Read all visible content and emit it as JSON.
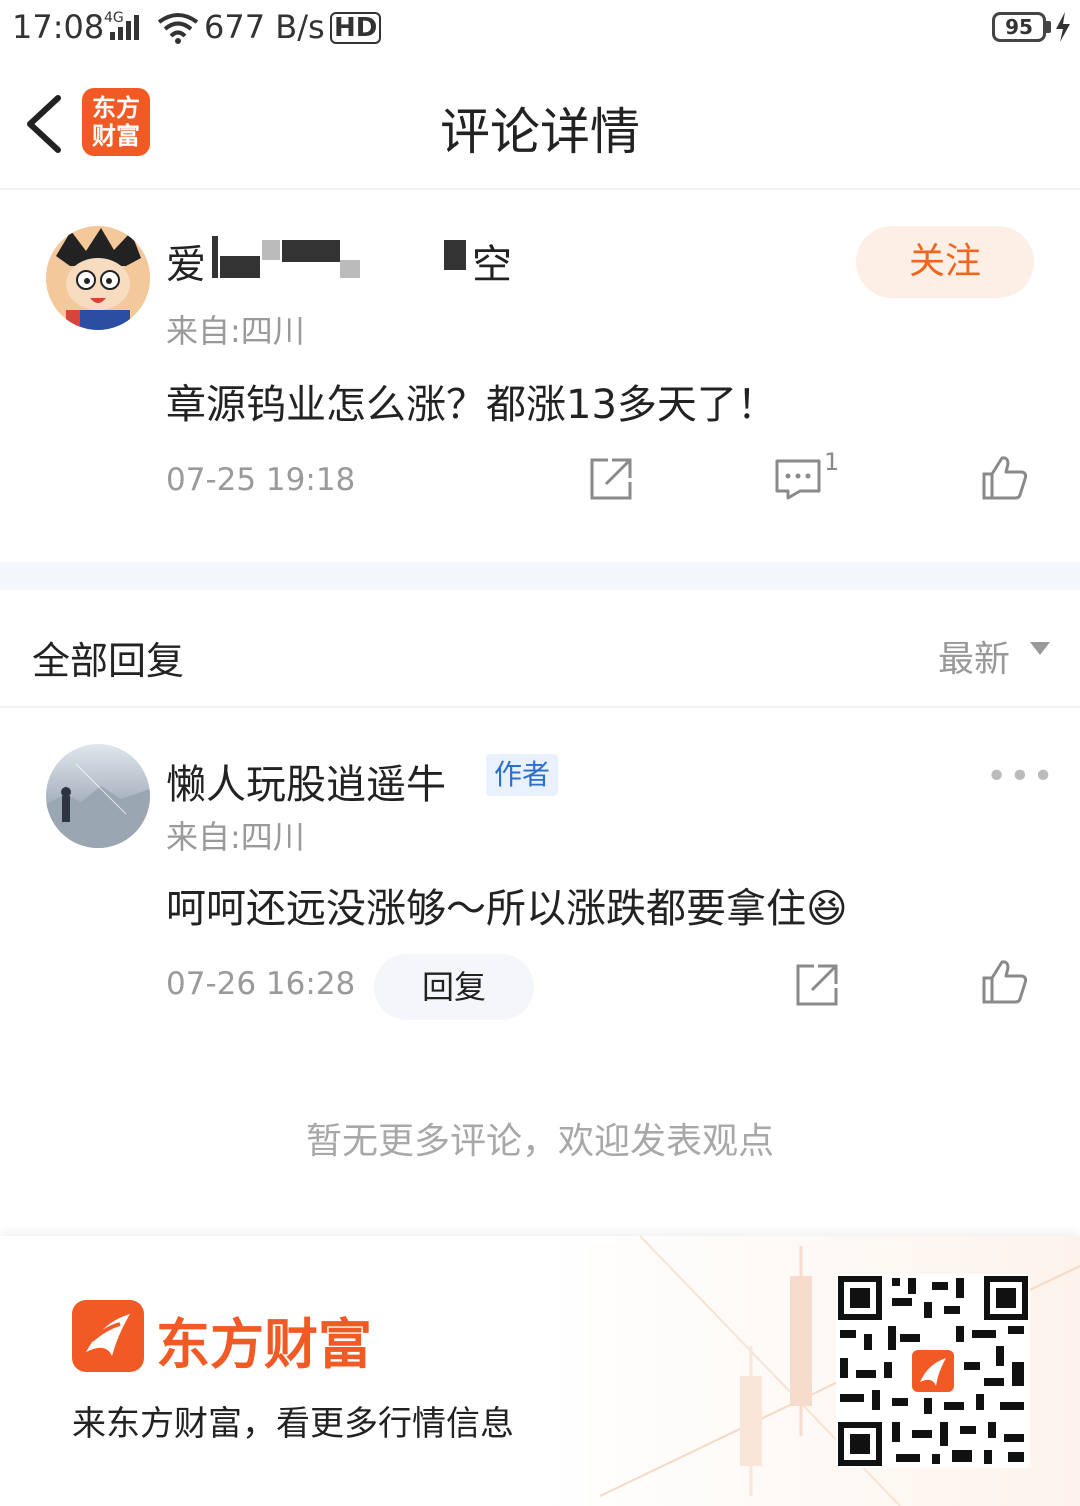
{
  "status_bar": {
    "time": "17:08",
    "network": "4G",
    "speed": "677 B/s",
    "hd": "HD",
    "battery": "95"
  },
  "header": {
    "back_icon": "chevron-left-icon",
    "brand_icon_line1": "东方",
    "brand_icon_line2": "财富",
    "title": "评论详情"
  },
  "post": {
    "username_prefix": "爱",
    "username_suffix": "空",
    "location": "来自:四川",
    "follow_label": "关注",
    "content": "章源钨业怎么涨？都涨13多天了！",
    "timestamp": "07-25 19:18",
    "comment_count": "1",
    "icons": [
      "share-icon",
      "comment-icon",
      "thumbs-up-icon"
    ]
  },
  "replies_section": {
    "title": "全部回复",
    "sort_label": "最新"
  },
  "reply": {
    "username": "懒人玩股逍遥牛",
    "badge": "作者",
    "location": "来自:四川",
    "content": "呵呵还远没涨够～所以涨跌都要拿住",
    "emoji": "😆",
    "timestamp": "07-26 16:28",
    "reply_label": "回复"
  },
  "empty_note": "暂无更多评论，欢迎发表观点",
  "footer": {
    "brand": "东方财富",
    "slogan": "来东方财富，看更多行情信息"
  },
  "colors": {
    "brand_orange": "#f15a24",
    "follow_text": "#f0661e",
    "badge_blue": "#2a6fce"
  }
}
